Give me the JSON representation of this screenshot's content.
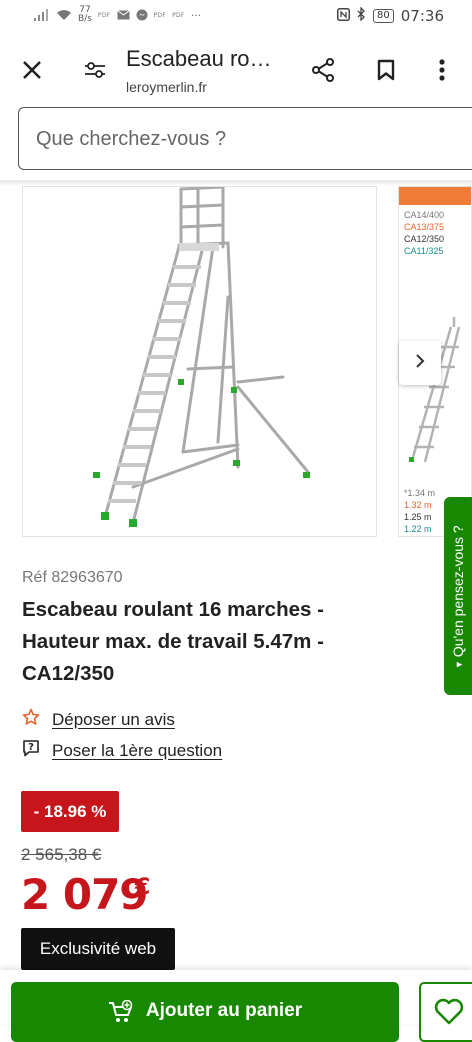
{
  "status_bar": {
    "net_speed": "77",
    "net_unit": "B/s",
    "tiny_labels": [
      "PDF",
      "PDF",
      "PDF"
    ],
    "more": "···",
    "battery": "80",
    "time": "07:36"
  },
  "header": {
    "title": "Escabeau ro…",
    "url": "leroymerlin.fr"
  },
  "search": {
    "placeholder": "Que cherchez-vous ?"
  },
  "carousel": {
    "specs_top": [
      {
        "text": "CA14/400",
        "color": "#777777"
      },
      {
        "text": "CA13/375",
        "color": "#e8632a"
      },
      {
        "text": "CA12/350",
        "color": "#333333"
      },
      {
        "text": "CA11/325",
        "color": "#1a8c8c"
      }
    ],
    "specs_bottom": [
      {
        "text": "*1.34 m",
        "color": "#777777"
      },
      {
        "text": "1.32 m",
        "color": "#e8632a"
      },
      {
        "text": "1.25 m",
        "color": "#333333"
      },
      {
        "text": "1.22 m",
        "color": "#1a8c8c"
      }
    ]
  },
  "feedback_tab": {
    "label": "Qu'en pensez-vous ?"
  },
  "product": {
    "ref": "Réf 82963670",
    "title": "Escabeau roulant 16 marches - Hauteur max. de travail 5.47m - CA12/350",
    "review_link": "Déposer un avis",
    "question_link": "Poser la 1ère question",
    "discount": "- 18.96 %",
    "old_price": "2 565,38 €",
    "price": "2 079",
    "currency": "€",
    "badge": "Exclusivité web"
  },
  "cta": {
    "add_to_cart": "Ajouter au panier"
  },
  "colors": {
    "brand_green": "#188803",
    "price_red": "#c6161b",
    "accent_orange": "#e8632a"
  }
}
